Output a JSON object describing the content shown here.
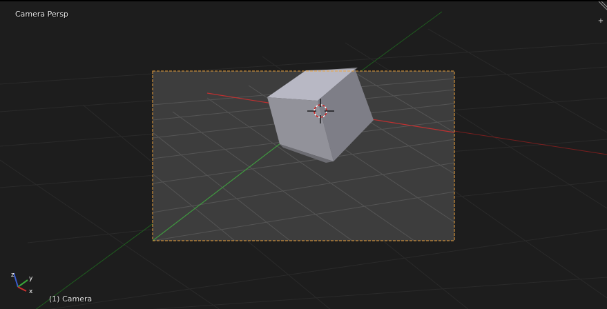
{
  "viewport": {
    "view_name": "Camera Persp",
    "object_info": "(1) Camera",
    "properties_toggle": "+"
  },
  "gizmo": {
    "x_label": "x",
    "y_label": "y",
    "z_label": "z"
  },
  "colors": {
    "background": "#1d1d1d",
    "grid": "#3a3a3a",
    "camera_frame": "#f0a33a",
    "x_axis": "#b42424",
    "y_axis": "#2e8b2e",
    "cube_top": "#b9b9c4",
    "cube_front": "#8e8e96",
    "cube_side": "#7b7b84"
  },
  "icons": {
    "area_split": "diagonal-lines-icon",
    "properties": "plus-icon",
    "cursor": "3d-cursor-icon"
  }
}
